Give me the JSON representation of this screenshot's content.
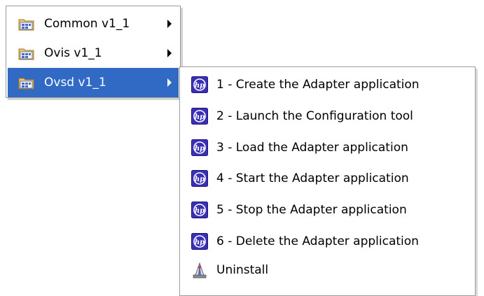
{
  "left_menu": {
    "items": [
      {
        "label": "Common v1_1",
        "icon": "folder-icon",
        "has_submenu": true,
        "selected": false
      },
      {
        "label": "Ovis v1_1",
        "icon": "folder-icon",
        "has_submenu": true,
        "selected": false
      },
      {
        "label": "Ovsd v1_1",
        "icon": "folder-icon",
        "has_submenu": true,
        "selected": true
      }
    ]
  },
  "submenu": {
    "items": [
      {
        "label": "1 - Create the Adapter application",
        "icon": "hp-icon"
      },
      {
        "label": "2 - Launch the Configuration tool",
        "icon": "hp-icon"
      },
      {
        "label": "3 - Load the Adapter application",
        "icon": "hp-icon"
      },
      {
        "label": "4 - Start the Adapter application",
        "icon": "hp-icon"
      },
      {
        "label": "5 - Stop the Adapter application",
        "icon": "hp-icon"
      },
      {
        "label": "6 - Delete the Adapter application",
        "icon": "hp-icon"
      },
      {
        "label": "Uninstall",
        "icon": "uninstall-icon"
      }
    ]
  },
  "colors": {
    "selection_background": "#316ac5",
    "selection_text": "#ffffff",
    "hp_icon_blue": "#3a2fb8"
  }
}
